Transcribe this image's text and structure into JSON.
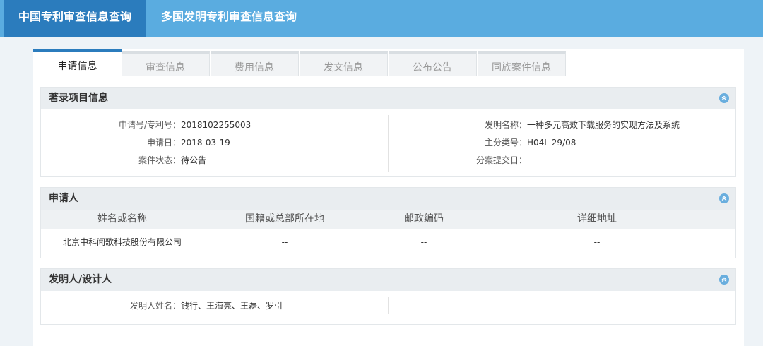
{
  "topnav": {
    "items": [
      {
        "label": "中国专利审查信息查询"
      },
      {
        "label": "多国发明专利审查信息查询"
      }
    ]
  },
  "tabs": [
    {
      "label": "申请信息"
    },
    {
      "label": "审查信息"
    },
    {
      "label": "费用信息"
    },
    {
      "label": "发文信息"
    },
    {
      "label": "公布公告"
    },
    {
      "label": "同族案件信息"
    }
  ],
  "bibliographic": {
    "title": "著录项目信息",
    "left": [
      {
        "key": "申请号/专利号：",
        "value": "2018102255003"
      },
      {
        "key": "申请日：",
        "value": "2018-03-19"
      },
      {
        "key": "案件状态：",
        "value": "待公告"
      }
    ],
    "right": [
      {
        "key": "发明名称：",
        "value": "一种多元高效下载服务的实现方法及系统"
      },
      {
        "key": "主分类号：",
        "value": "H04L 29/08"
      },
      {
        "key": "分案提交日：",
        "value": ""
      }
    ]
  },
  "applicant": {
    "title": "申请人",
    "columns": [
      "姓名或名称",
      "国籍或总部所在地",
      "邮政编码",
      "详细地址"
    ],
    "rows": [
      [
        "北京中科闻歌科技股份有限公司",
        "--",
        "--",
        "--"
      ]
    ]
  },
  "inventor": {
    "title": "发明人/设计人",
    "key": "发明人姓名：",
    "value": "钱行、王海亮、王磊、罗引"
  },
  "colors": {
    "topbar": "#5aace0",
    "topnav_active": "#2b7cbd",
    "section_header": "#e9edf0",
    "collapse_icon": "#69aede"
  }
}
